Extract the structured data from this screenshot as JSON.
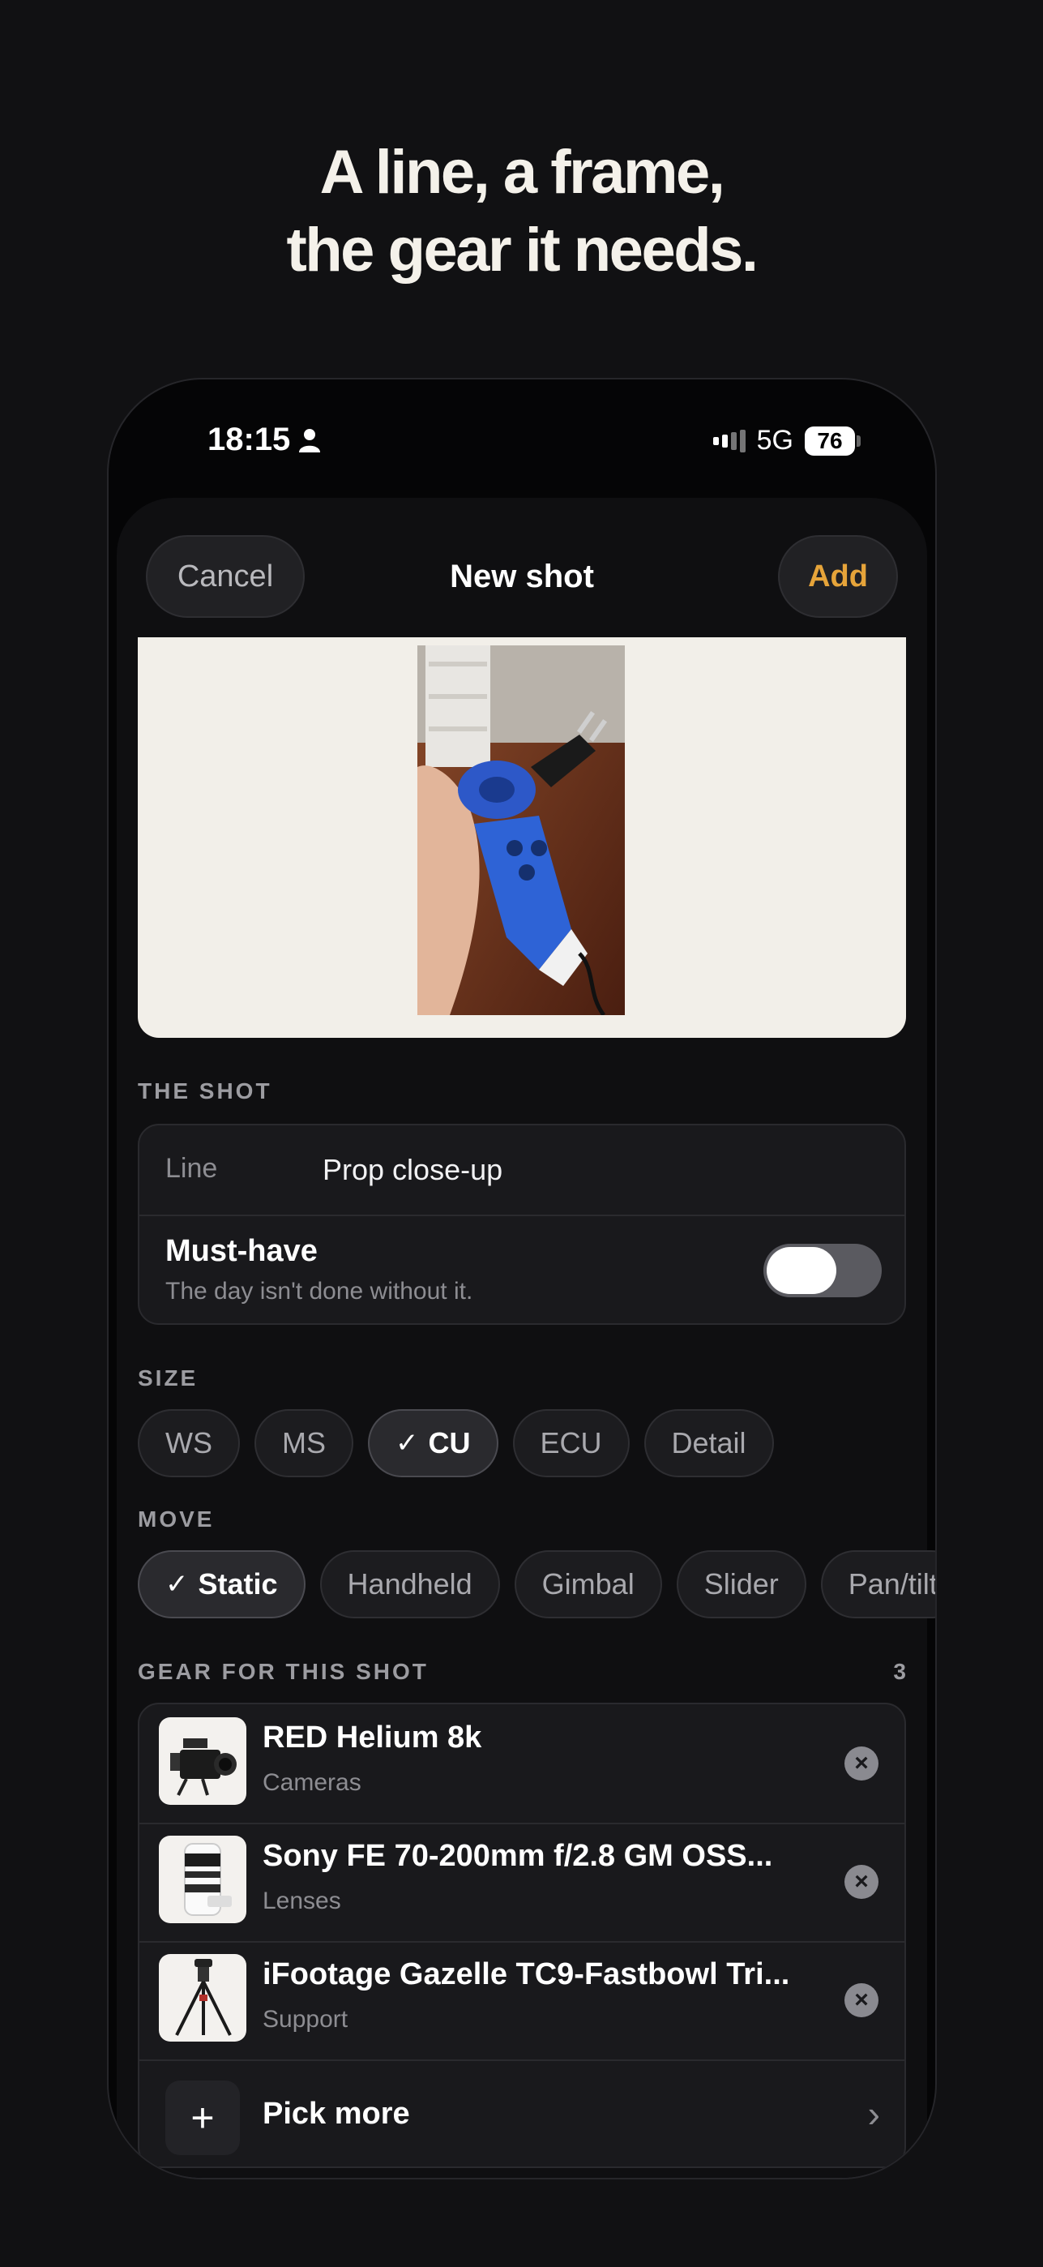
{
  "headline": {
    "line1": "A line, a frame,",
    "line2": "the gear it needs."
  },
  "status_bar": {
    "time": "18:15",
    "network": "5G",
    "battery": "76"
  },
  "nav": {
    "cancel": "Cancel",
    "title": "New shot",
    "add": "Add"
  },
  "the_shot": {
    "section_label": "THE SHOT",
    "line_label": "Line",
    "line_value": "Prop close-up",
    "must_have_title": "Must-have",
    "must_have_subtitle": "The day isn't done without it.",
    "must_have_on": false
  },
  "size": {
    "section_label": "SIZE",
    "options": [
      "WS",
      "MS",
      "CU",
      "ECU",
      "Detail"
    ],
    "selected": "CU"
  },
  "move": {
    "section_label": "MOVE",
    "options": [
      "Static",
      "Handheld",
      "Gimbal",
      "Slider",
      "Pan/tilt"
    ],
    "selected": "Static"
  },
  "gear": {
    "section_label": "GEAR FOR THIS SHOT",
    "count": "3",
    "items": [
      {
        "name": "RED Helium 8k",
        "category": "Cameras",
        "icon": "camera-thumb"
      },
      {
        "name": "Sony FE 70-200mm f/2.8 GM OSS...",
        "category": "Lenses",
        "icon": "lens-thumb"
      },
      {
        "name": "iFootage Gazelle TC9-Fastbowl Tri...",
        "category": "Support",
        "icon": "tripod-thumb"
      }
    ],
    "pick_more": "Pick more"
  },
  "colors": {
    "accent": "#e6a43a",
    "background": "#111113",
    "card": "#19191c"
  }
}
